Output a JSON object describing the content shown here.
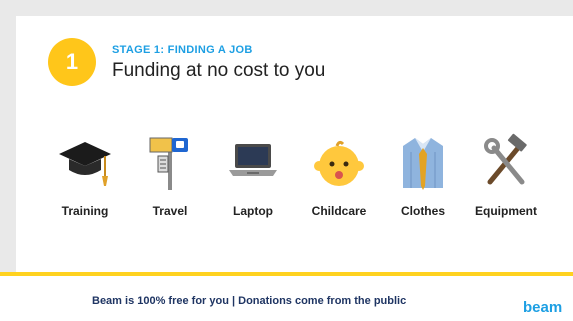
{
  "stage": {
    "number": "1",
    "kicker": "STAGE 1: FINDING A JOB",
    "title": "Funding at no cost to you"
  },
  "items": [
    {
      "label": "Training",
      "icon": "graduation-cap-icon"
    },
    {
      "label": "Travel",
      "icon": "bus-stop-icon"
    },
    {
      "label": "Laptop",
      "icon": "laptop-icon"
    },
    {
      "label": "Childcare",
      "icon": "baby-face-icon"
    },
    {
      "label": "Clothes",
      "icon": "shirt-tie-icon"
    },
    {
      "label": "Equipment",
      "icon": "hammer-wrench-icon"
    }
  ],
  "footer": {
    "text": "Beam is 100% free for you   |   Donations come from the public",
    "brand": "beam"
  },
  "colors": {
    "accent_yellow": "#ffc61a",
    "brand_blue": "#1d9fe3",
    "footer_text": "#1f3563"
  }
}
